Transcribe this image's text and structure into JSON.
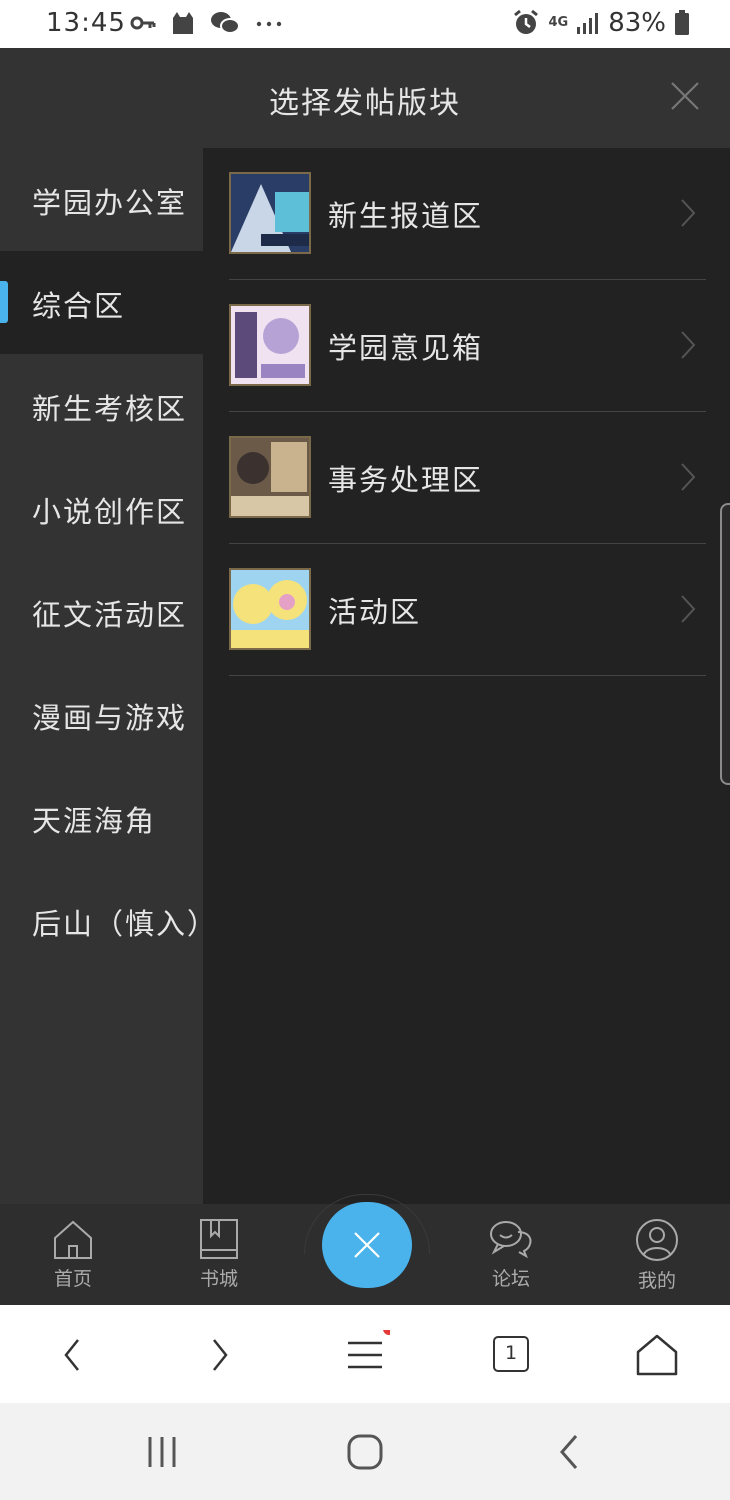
{
  "status_bar": {
    "time": "13:45",
    "battery": "83%",
    "network": "4G",
    "icons": [
      "key-icon",
      "cat-icon",
      "wechat-icon",
      "more-icon",
      "alarm-icon",
      "signal-icon",
      "battery-icon"
    ]
  },
  "header": {
    "title": "选择发帖版块",
    "close_icon": "close-icon"
  },
  "sidebar": {
    "items": [
      {
        "label": "学园办公室",
        "active": false
      },
      {
        "label": "综合区",
        "active": true
      },
      {
        "label": "新生考核区",
        "active": false
      },
      {
        "label": "小说创作区",
        "active": false
      },
      {
        "label": "征文活动区",
        "active": false
      },
      {
        "label": "漫画与游戏",
        "active": false
      },
      {
        "label": "天涯海角",
        "active": false
      },
      {
        "label": "后山（慎入）",
        "active": false
      }
    ]
  },
  "boards": [
    {
      "name": "新生报道区",
      "thumb_colors": [
        "#2a3d66",
        "#5dc0d8",
        "#c9d6e8"
      ]
    },
    {
      "name": "学园意见箱",
      "thumb_colors": [
        "#b7a2d6",
        "#f0e2f0",
        "#5c4a7a"
      ]
    },
    {
      "name": "事务处理区",
      "thumb_colors": [
        "#6b5a48",
        "#c9b28e",
        "#3b3230"
      ]
    },
    {
      "name": "活动区",
      "thumb_colors": [
        "#f5e27a",
        "#9ed4ef",
        "#e4a1c5"
      ]
    }
  ],
  "tabbar": {
    "tabs": [
      {
        "label": "首页",
        "icon": "home-icon"
      },
      {
        "label": "书城",
        "icon": "book-icon"
      },
      {
        "label": "论坛",
        "icon": "chat-icon"
      },
      {
        "label": "我的",
        "icon": "user-icon"
      }
    ],
    "fab_icon": "close-icon"
  },
  "browser_bar": {
    "tab_count": "1",
    "icons": [
      "back-icon",
      "forward-icon",
      "menu-icon",
      "tabs-icon",
      "home-icon"
    ]
  },
  "colors": {
    "accent": "#4ab3ec",
    "panel": "#333333",
    "content": "#222222",
    "notify_dot": "#e53935"
  }
}
